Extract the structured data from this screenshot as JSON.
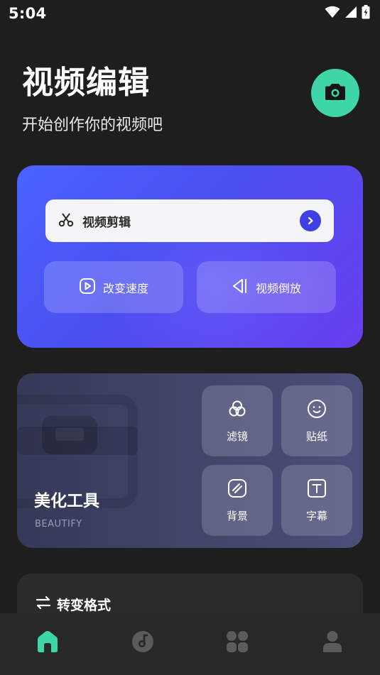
{
  "status_bar": {
    "time": "5:04",
    "icons": [
      "wifi-icon",
      "signal-icon",
      "battery-icon"
    ]
  },
  "header": {
    "title": "视频编辑",
    "subtitle": "开始创作你的视频吧",
    "camera_button_icon": "camera-icon"
  },
  "edit_card": {
    "main_action": {
      "label": "视频剪辑",
      "icon": "scissors-icon",
      "go_icon": "chevron-right-icon"
    },
    "actions": [
      {
        "label": "改变速度",
        "icon": "play-square-icon"
      },
      {
        "label": "视频倒放",
        "icon": "reverse-icon"
      }
    ]
  },
  "beautify_card": {
    "title": "美化工具",
    "subtitle": "BEAUTIFY",
    "tools": [
      {
        "label": "滤镜",
        "icon": "filter-icon"
      },
      {
        "label": "贴纸",
        "icon": "smile-icon"
      },
      {
        "label": "背景",
        "icon": "background-icon"
      },
      {
        "label": "字幕",
        "icon": "text-icon"
      }
    ]
  },
  "format_card": {
    "title": "转变格式",
    "icon": "swap-icon"
  },
  "bottom_nav": {
    "items": [
      {
        "name": "home",
        "icon": "home-icon",
        "active": true
      },
      {
        "name": "music",
        "icon": "music-disc-icon",
        "active": false
      },
      {
        "name": "apps",
        "icon": "grid-icon",
        "active": false
      },
      {
        "name": "profile",
        "icon": "user-icon",
        "active": false
      }
    ]
  },
  "colors": {
    "background": "#1e1e1e",
    "accent_green": "#3ed6a6",
    "edit_card_blue": "#4a54f5",
    "edit_card_purple": "#6a3ef0",
    "beautify_card": "#42466a",
    "nav_inactive": "#5b5b5b"
  }
}
